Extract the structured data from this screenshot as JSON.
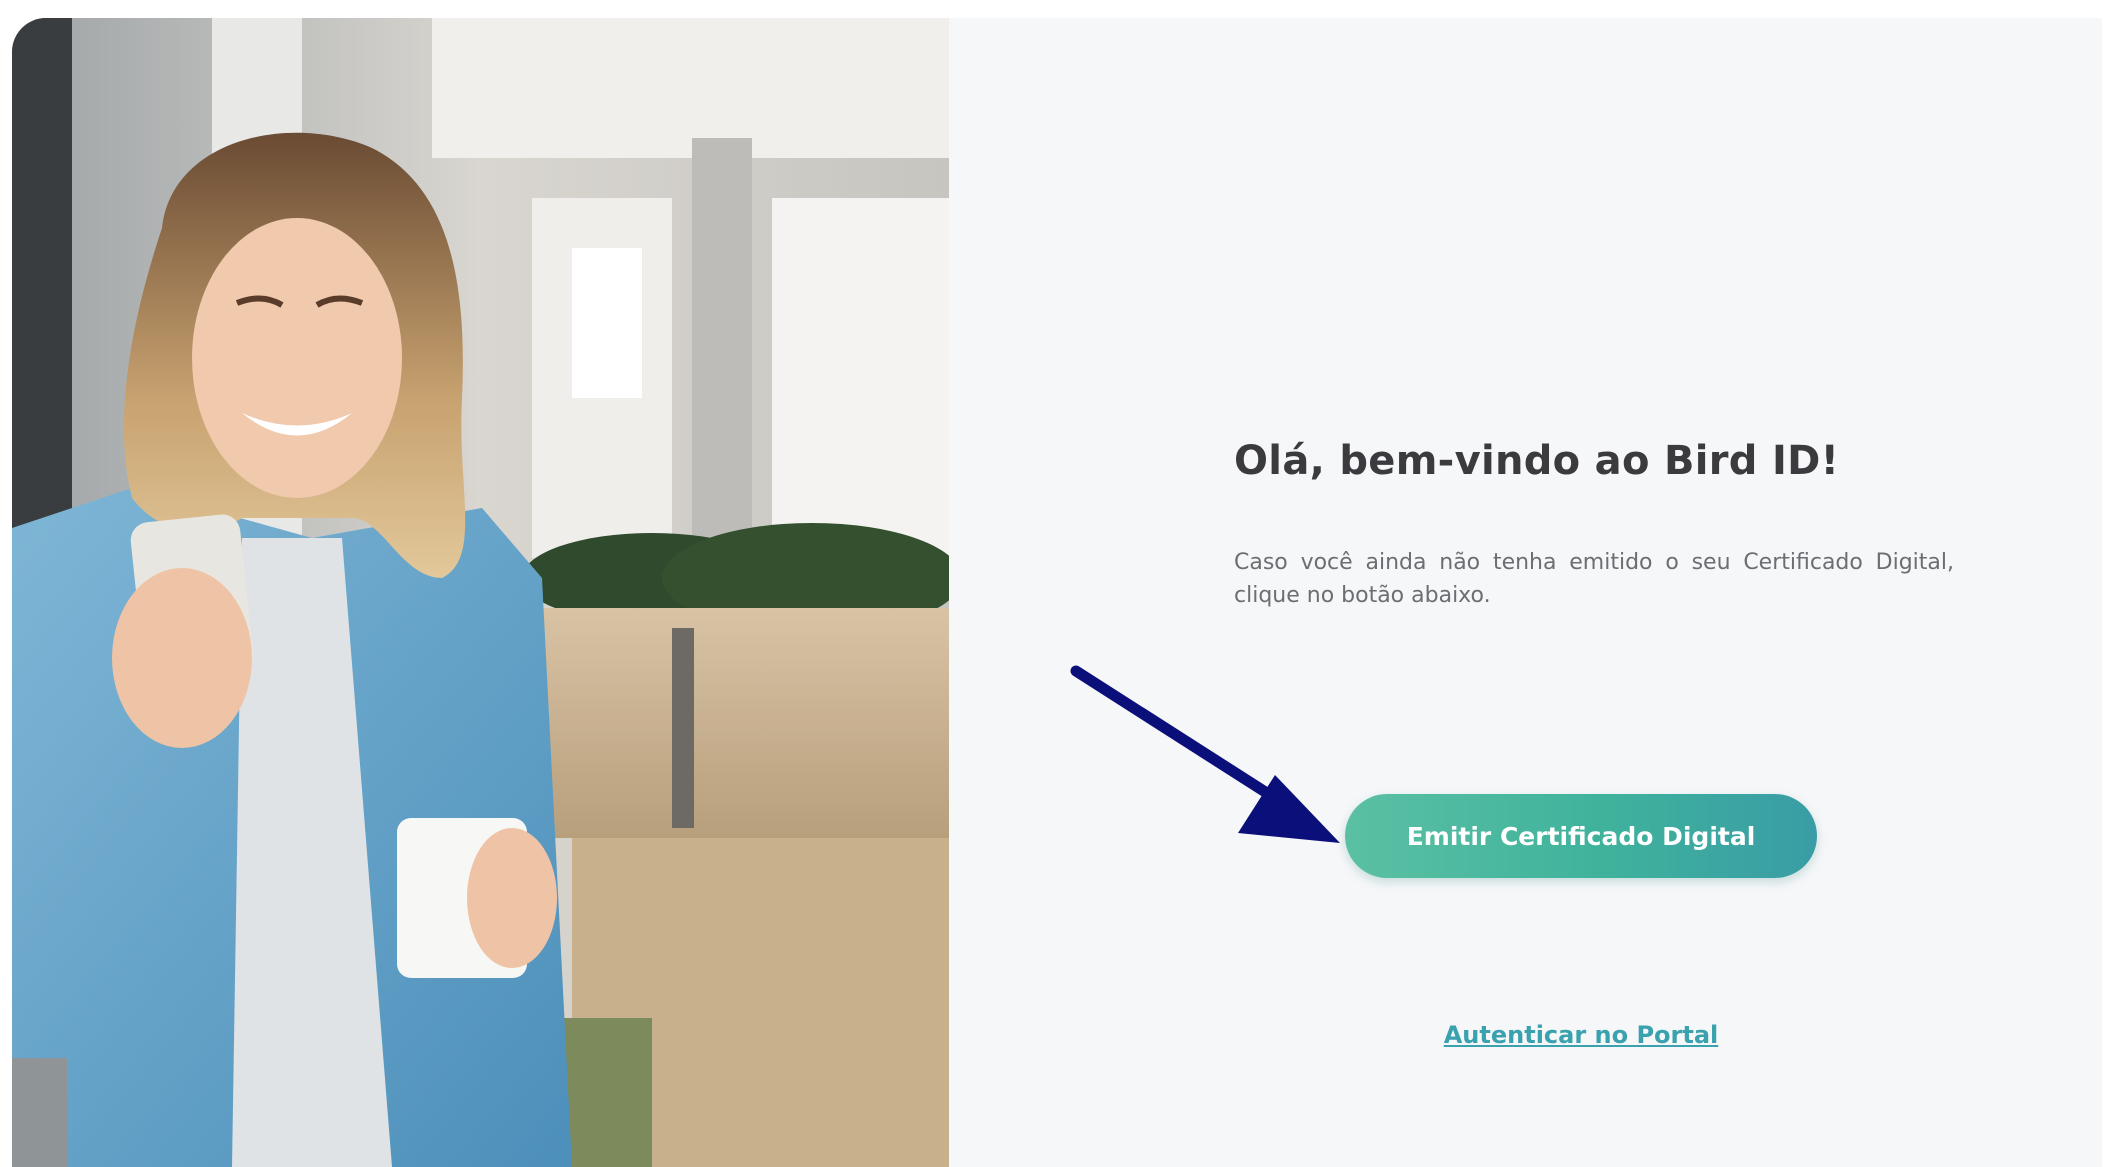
{
  "welcome": {
    "title": "Olá, bem-vindo ao Bird ID!",
    "description": "Caso você ainda não tenha emitido o seu Certificado Digital, clique no botão abaixo."
  },
  "actions": {
    "primary_label": "Emitir Certificado Digital",
    "link_label": "Autenticar no Portal"
  },
  "annotation": {
    "arrow_icon": "arrow-down-right-icon",
    "arrow_color": "#0b0f7a"
  },
  "colors": {
    "button_gradient_start": "#5bc0a3",
    "button_gradient_end": "#3a9ca6",
    "link": "#3aa2ae",
    "title": "#3b3b3f",
    "background": "#f6f7f9"
  }
}
